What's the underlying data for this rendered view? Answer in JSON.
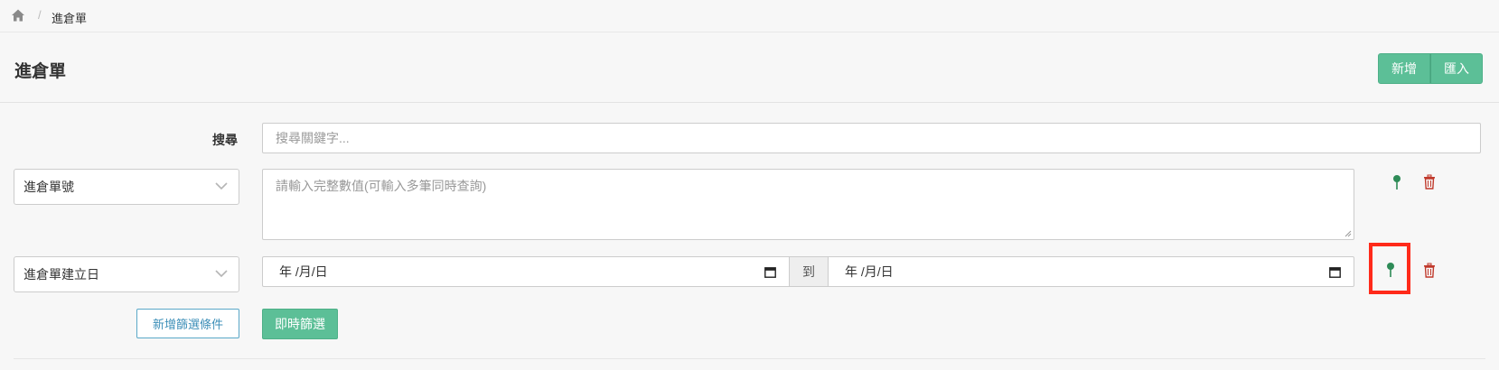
{
  "breadcrumb": {
    "separator": "/",
    "current": "進倉單",
    "home_icon": "home-icon"
  },
  "header": {
    "title": "進倉單",
    "add_label": "新增",
    "import_label": "匯入"
  },
  "search": {
    "label": "搜尋",
    "placeholder": "搜尋關鍵字..."
  },
  "filters": [
    {
      "field": "進倉單號",
      "placeholder": "請輸入完整數值(可輸入多筆同時查詢)"
    },
    {
      "field": "進倉單建立日",
      "date_from": "年 /月/日",
      "range_sep": "到",
      "date_to": "年 /月/日"
    }
  ],
  "actions": {
    "add_filter_label": "新增篩選條件",
    "instant_filter_label": "即時篩選"
  },
  "colors": {
    "accent_green": "#5cbf97",
    "pin_green": "#2e8b57",
    "trash_red": "#c0392b",
    "highlight": "#ff2a1a",
    "outline_blue": "#5aa8c8"
  }
}
